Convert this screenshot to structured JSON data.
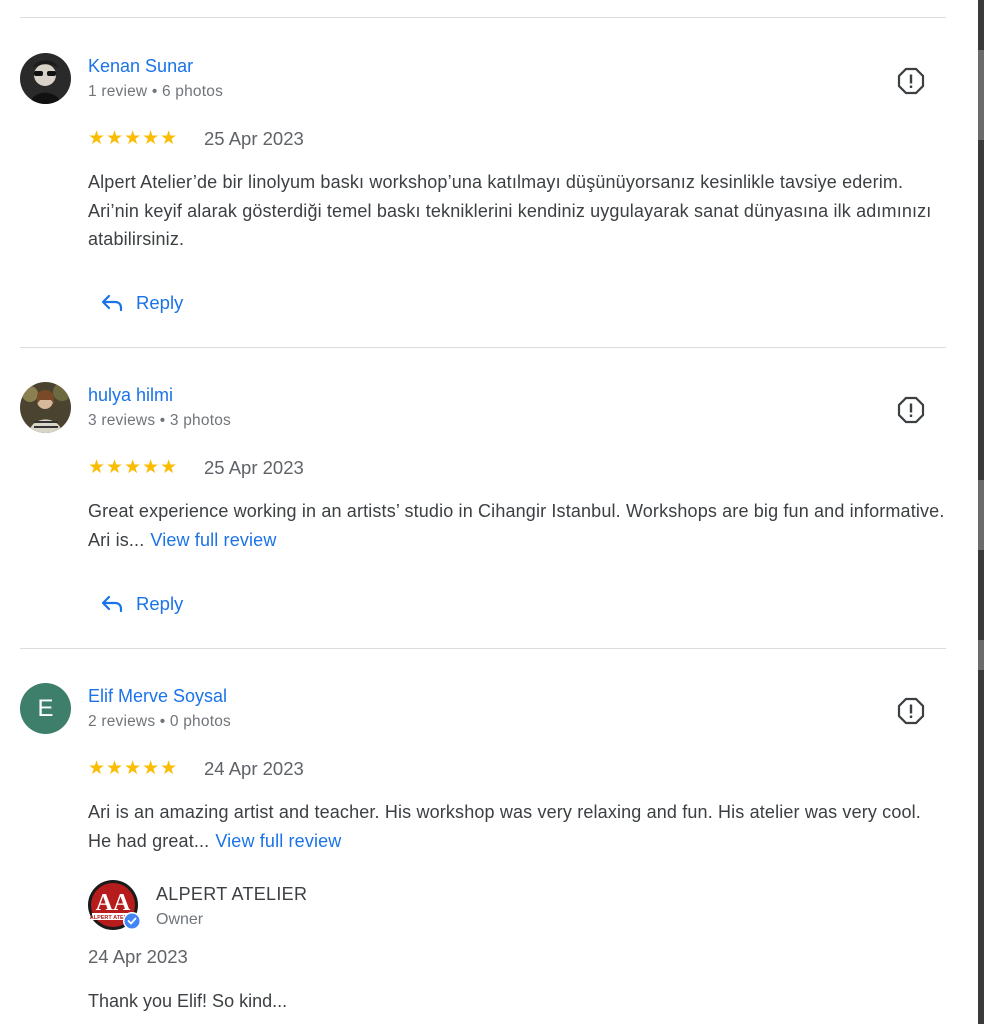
{
  "reviews": [
    {
      "name": "Kenan Sunar",
      "meta": "1 review • 6 photos",
      "stars": "★★★★★",
      "rating": 5,
      "date": "25 Apr 2023",
      "text": "Alpert Atelier’de bir linolyum baskı workshop’una katılmayı düşünüyorsanız kesinlikle tavsiye ederim. Ari’nin keyif alarak gösterdiği temel baskı tekniklerini kendiniz uygulayarak sanat dünyasına ilk adımınızı atabilirsiniz.",
      "reply_label": "Reply"
    },
    {
      "name": "hulya hilmi",
      "meta": "3 reviews • 3 photos",
      "stars": "★★★★★",
      "rating": 5,
      "date": "25 Apr 2023",
      "text": "Great experience working in an artists’ studio in Cihangir Istanbul. Workshops are big fun and informative. Ari is...",
      "view_full": "View full review",
      "reply_label": "Reply"
    },
    {
      "name": "Elif Merve Soysal",
      "avatar_letter": "E",
      "meta": "2 reviews • 0 photos",
      "stars": "★★★★★",
      "rating": 5,
      "date": "24 Apr 2023",
      "text": "Ari is an amazing artist and teacher. His workshop was very relaxing and fun. His atelier was very cool. He had great...",
      "view_full": "View full review",
      "owner_response": {
        "name": "ALPERT ATELIER",
        "role": "Owner",
        "date": "24 Apr 2023",
        "text": "Thank you Elif! So kind...",
        "logo_letters": "AA",
        "logo_caption": "ALPERT ATELIER"
      }
    }
  ],
  "icons": {
    "flag": "report-flag-icon",
    "reply": "reply-arrow-icon",
    "verified": "verified-check-icon"
  },
  "colors": {
    "link": "#1a73e8",
    "star": "#fbbc04",
    "avatar_letter_bg": "#3e7f6c",
    "owner_logo": "#b71c1c"
  }
}
